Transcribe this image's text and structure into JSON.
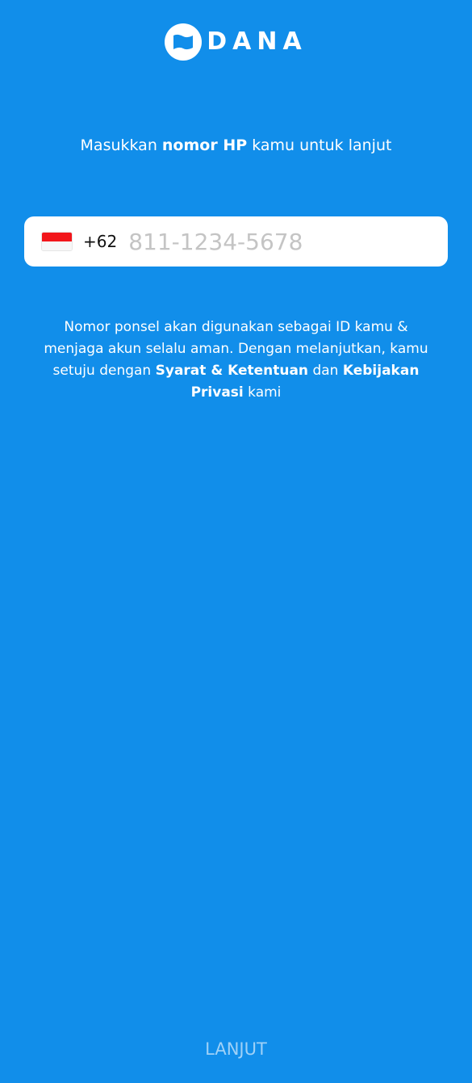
{
  "brand": {
    "logo_text": "DANA",
    "logo_icon": "dana-wallet-icon"
  },
  "prompt": {
    "before": "Masukkan ",
    "bold": "nomor HP",
    "after": " kamu untuk lanjut"
  },
  "phone": {
    "flag_icon": "indonesia-flag-icon",
    "country_code": "+62",
    "value": "",
    "placeholder": "811-1234-5678"
  },
  "notice": {
    "text_1": "Nomor ponsel akan digunakan sebagai ID kamu & menjaga akun selalu aman. Dengan melanjutkan, kamu setuju dengan ",
    "terms_link": "Syarat & Ketentuan",
    "text_2": " dan ",
    "privacy_link": "Kebijakan Privasi",
    "text_3": " kami"
  },
  "actions": {
    "continue_label": "LANJUT"
  },
  "colors": {
    "background": "#118eea",
    "text": "#ffffff",
    "flag_red": "#f2161b",
    "placeholder": "#c4c4c4",
    "continue_disabled": "#9fd1f7"
  }
}
